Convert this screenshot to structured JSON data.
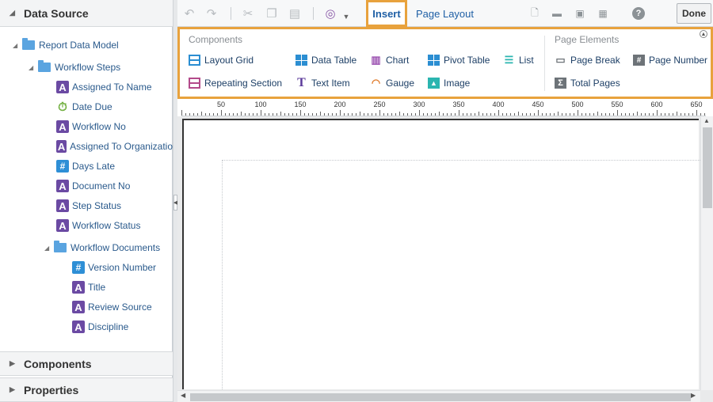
{
  "left_panel": {
    "data_source_title": "Data Source",
    "tree": {
      "root": "Report Data Model",
      "workflow_steps": {
        "label": "Workflow Steps",
        "fields": [
          {
            "label": "Assigned To Name",
            "type": "text"
          },
          {
            "label": "Date Due",
            "type": "date"
          },
          {
            "label": "Workflow No",
            "type": "text"
          },
          {
            "label": "Assigned To Organizatio",
            "type": "text"
          },
          {
            "label": "Days Late",
            "type": "number"
          },
          {
            "label": "Document No",
            "type": "text"
          },
          {
            "label": "Step Status",
            "type": "text"
          },
          {
            "label": "Workflow Status",
            "type": "text"
          }
        ]
      },
      "workflow_documents": {
        "label": "Workflow Documents",
        "fields": [
          {
            "label": "Version Number",
            "type": "number"
          },
          {
            "label": "Title",
            "type": "text"
          },
          {
            "label": "Review Source",
            "type": "text"
          },
          {
            "label": "Discipline",
            "type": "text"
          }
        ]
      }
    },
    "components_title": "Components",
    "properties_title": "Properties"
  },
  "toolbar": {
    "tabs": {
      "insert": "Insert",
      "page_layout": "Page Layout"
    },
    "done_label": "Done",
    "icons": [
      "undo-icon",
      "redo-icon",
      "cut-icon",
      "copy-icon",
      "paste-icon",
      "target-icon",
      "chevron-down-icon",
      "new-page-icon",
      "open-folder-icon",
      "save-icon",
      "save-as-icon",
      "help-icon"
    ]
  },
  "ribbon": {
    "components_title": "Components",
    "page_elements_title": "Page Elements",
    "components": {
      "layout_grid": "Layout Grid",
      "data_table": "Data Table",
      "chart": "Chart",
      "pivot_table": "Pivot Table",
      "list": "List",
      "repeating_section": "Repeating Section",
      "text_item": "Text Item",
      "gauge": "Gauge",
      "image": "Image"
    },
    "page_elements": {
      "page_break": "Page Break",
      "page_number": "Page Number",
      "total_pages": "Total Pages"
    }
  },
  "ruler": {
    "labels": [
      "50",
      "100",
      "150",
      "200",
      "250",
      "300",
      "350",
      "400",
      "450",
      "500",
      "550",
      "600",
      "650"
    ]
  },
  "colors": {
    "highlight": "#e8a23d",
    "link_blue": "#1f5fa5",
    "text_field_icon": "#6b4aa3",
    "number_field_icon": "#2e8fd6",
    "folder": "#5aa4e0"
  }
}
